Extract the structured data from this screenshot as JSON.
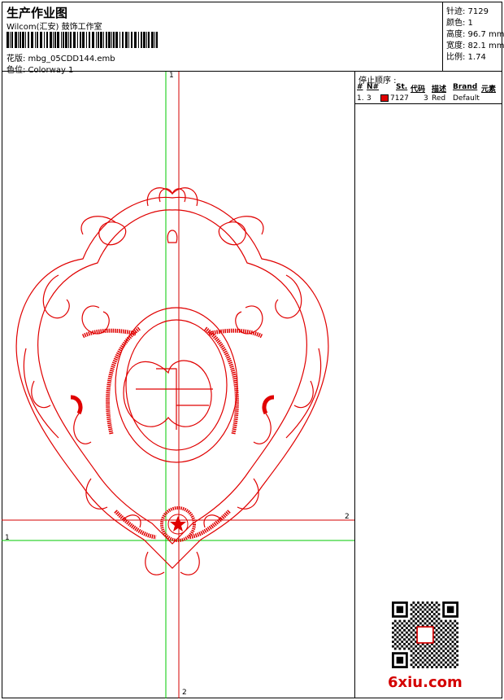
{
  "header": {
    "title": "生产作业图",
    "company": "Wilcom(汇安) 鼓饰工作室",
    "file": "花版: mbg_05CDD144.emb",
    "colorway": "色位: Colorway 1"
  },
  "stats": [
    "针迹: 7129",
    "颜色: 1",
    "高度: 96.7 mm",
    "宽度: 82.1 mm",
    "比例: 1.74"
  ],
  "stop_sequence": {
    "title": "停止顺序 :",
    "headers": [
      "#",
      "N#",
      "St.",
      "代码",
      "描述",
      "Brand",
      "元素"
    ],
    "rows": [
      {
        "index": "1.",
        "needle": "3",
        "stitches": "7127",
        "code": "3",
        "description": "Red",
        "brand": "Default",
        "swatch_color": "#e00000"
      }
    ]
  },
  "axis_labels": {
    "v1": "1",
    "h2": "2",
    "h1": "1",
    "v2": "2"
  },
  "watermark": "6xiu.com",
  "colors": {
    "thread": "#e00000",
    "guide_green": "#00c800",
    "guide_red": "#d40000"
  },
  "icons": {
    "barcode": "barcode-icon",
    "qr": "qr-code-icon"
  }
}
